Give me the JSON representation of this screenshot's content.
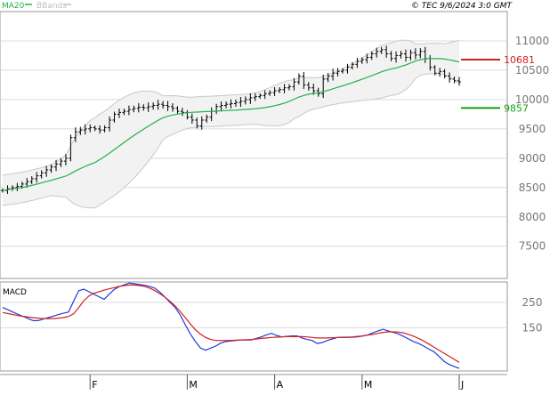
{
  "header": {
    "ma_label": "MA20",
    "bbands_label": "BBands",
    "copyright": "© TEC 9/6/2024 3:0 GMT"
  },
  "colors": {
    "ma20": "#22b14c",
    "bbands": "#c8c8c8",
    "price_bars": "#000000",
    "macd_line": "#1f3bd8",
    "signal_line": "#d41f1f",
    "resistance": "#d41f1f",
    "support": "#1a9e1a",
    "grid": "#dcdcdc"
  },
  "macd_panel": {
    "label": "MACD",
    "tick_labels": [
      "250",
      "150"
    ]
  },
  "chart_data": [
    {
      "type": "ohlc",
      "panel": "price",
      "y_ticks": [
        7500,
        8000,
        8500,
        9000,
        9500,
        10000,
        10500,
        11000
      ],
      "y_tick_labels": [
        "7500",
        "8000",
        "8500",
        "9000",
        "9500",
        "10000",
        "10500",
        "11000"
      ],
      "ylim": [
        6950,
        11500
      ],
      "x_labels": [
        "F",
        "M",
        "A",
        "M",
        "J"
      ],
      "overlays": [
        "MA20",
        "BBands"
      ],
      "levels": [
        {
          "name": "resistance",
          "value": 10681,
          "label": "10681"
        },
        {
          "name": "support",
          "value": 9857,
          "label": "9857"
        }
      ],
      "close": [
        8450,
        8480,
        8500,
        8520,
        8560,
        8600,
        8650,
        8700,
        8750,
        8800,
        8850,
        8900,
        8950,
        9000,
        9350,
        9450,
        9480,
        9500,
        9520,
        9500,
        9480,
        9520,
        9650,
        9750,
        9780,
        9800,
        9830,
        9850,
        9870,
        9860,
        9880,
        9900,
        9920,
        9900,
        9880,
        9850,
        9800,
        9780,
        9700,
        9650,
        9550,
        9650,
        9700,
        9800,
        9880,
        9900,
        9920,
        9930,
        9950,
        9970,
        10000,
        10030,
        10050,
        10070,
        10100,
        10120,
        10150,
        10170,
        10200,
        10220,
        10300,
        10400,
        10250,
        10200,
        10150,
        10100,
        10350,
        10400,
        10450,
        10480,
        10500,
        10550,
        10600,
        10650,
        10680,
        10720,
        10780,
        10820,
        10850,
        10780,
        10700,
        10750,
        10780,
        10720,
        10800,
        10760,
        10820,
        10700,
        10550,
        10450,
        10480,
        10400,
        10350,
        10320,
        10300
      ]
    },
    {
      "type": "line",
      "panel": "macd",
      "series": [
        {
          "name": "MACD",
          "values": [
            230,
            221,
            212,
            203,
            195,
            186,
            178,
            178,
            184,
            190,
            196,
            202,
            207,
            212,
            255,
            296,
            302,
            292,
            282,
            272,
            262,
            282,
            301,
            312,
            319,
            326,
            323,
            320,
            317,
            312,
            306,
            290,
            270,
            250,
            230,
            200,
            162,
            126,
            96,
            70,
            62,
            70,
            78,
            90,
            96,
            98,
            100,
            102,
            102,
            102,
            108,
            114,
            122,
            128,
            120,
            114,
            116,
            118,
            118,
            110,
            104,
            100,
            88,
            92,
            100,
            106,
            112,
            112,
            112,
            113,
            114,
            118,
            122,
            130,
            138,
            144,
            138,
            132,
            126,
            116,
            106,
            96,
            88,
            78,
            66,
            56,
            38,
            18,
            6,
            -2,
            -10
          ]
        },
        {
          "name": "Signal",
          "values": [
            210,
            206,
            202,
            198,
            195,
            192,
            190,
            188,
            186,
            186,
            186,
            188,
            190,
            195,
            205,
            230,
            256,
            275,
            286,
            292,
            298,
            303,
            308,
            313,
            316,
            318,
            318,
            316,
            313,
            306,
            296,
            284,
            270,
            254,
            236,
            214,
            190,
            165,
            142,
            125,
            112,
            104,
            100,
            100,
            100,
            100,
            101,
            102,
            103,
            104,
            106,
            108,
            110,
            112,
            113,
            114,
            115,
            115,
            115,
            115,
            114,
            112,
            110,
            110,
            110,
            111,
            112,
            113,
            113,
            114,
            116,
            118,
            121,
            124,
            128,
            132,
            134,
            134,
            133,
            130,
            124,
            117,
            108,
            98,
            86,
            74,
            62,
            50,
            38,
            26,
            14
          ]
        }
      ]
    }
  ]
}
